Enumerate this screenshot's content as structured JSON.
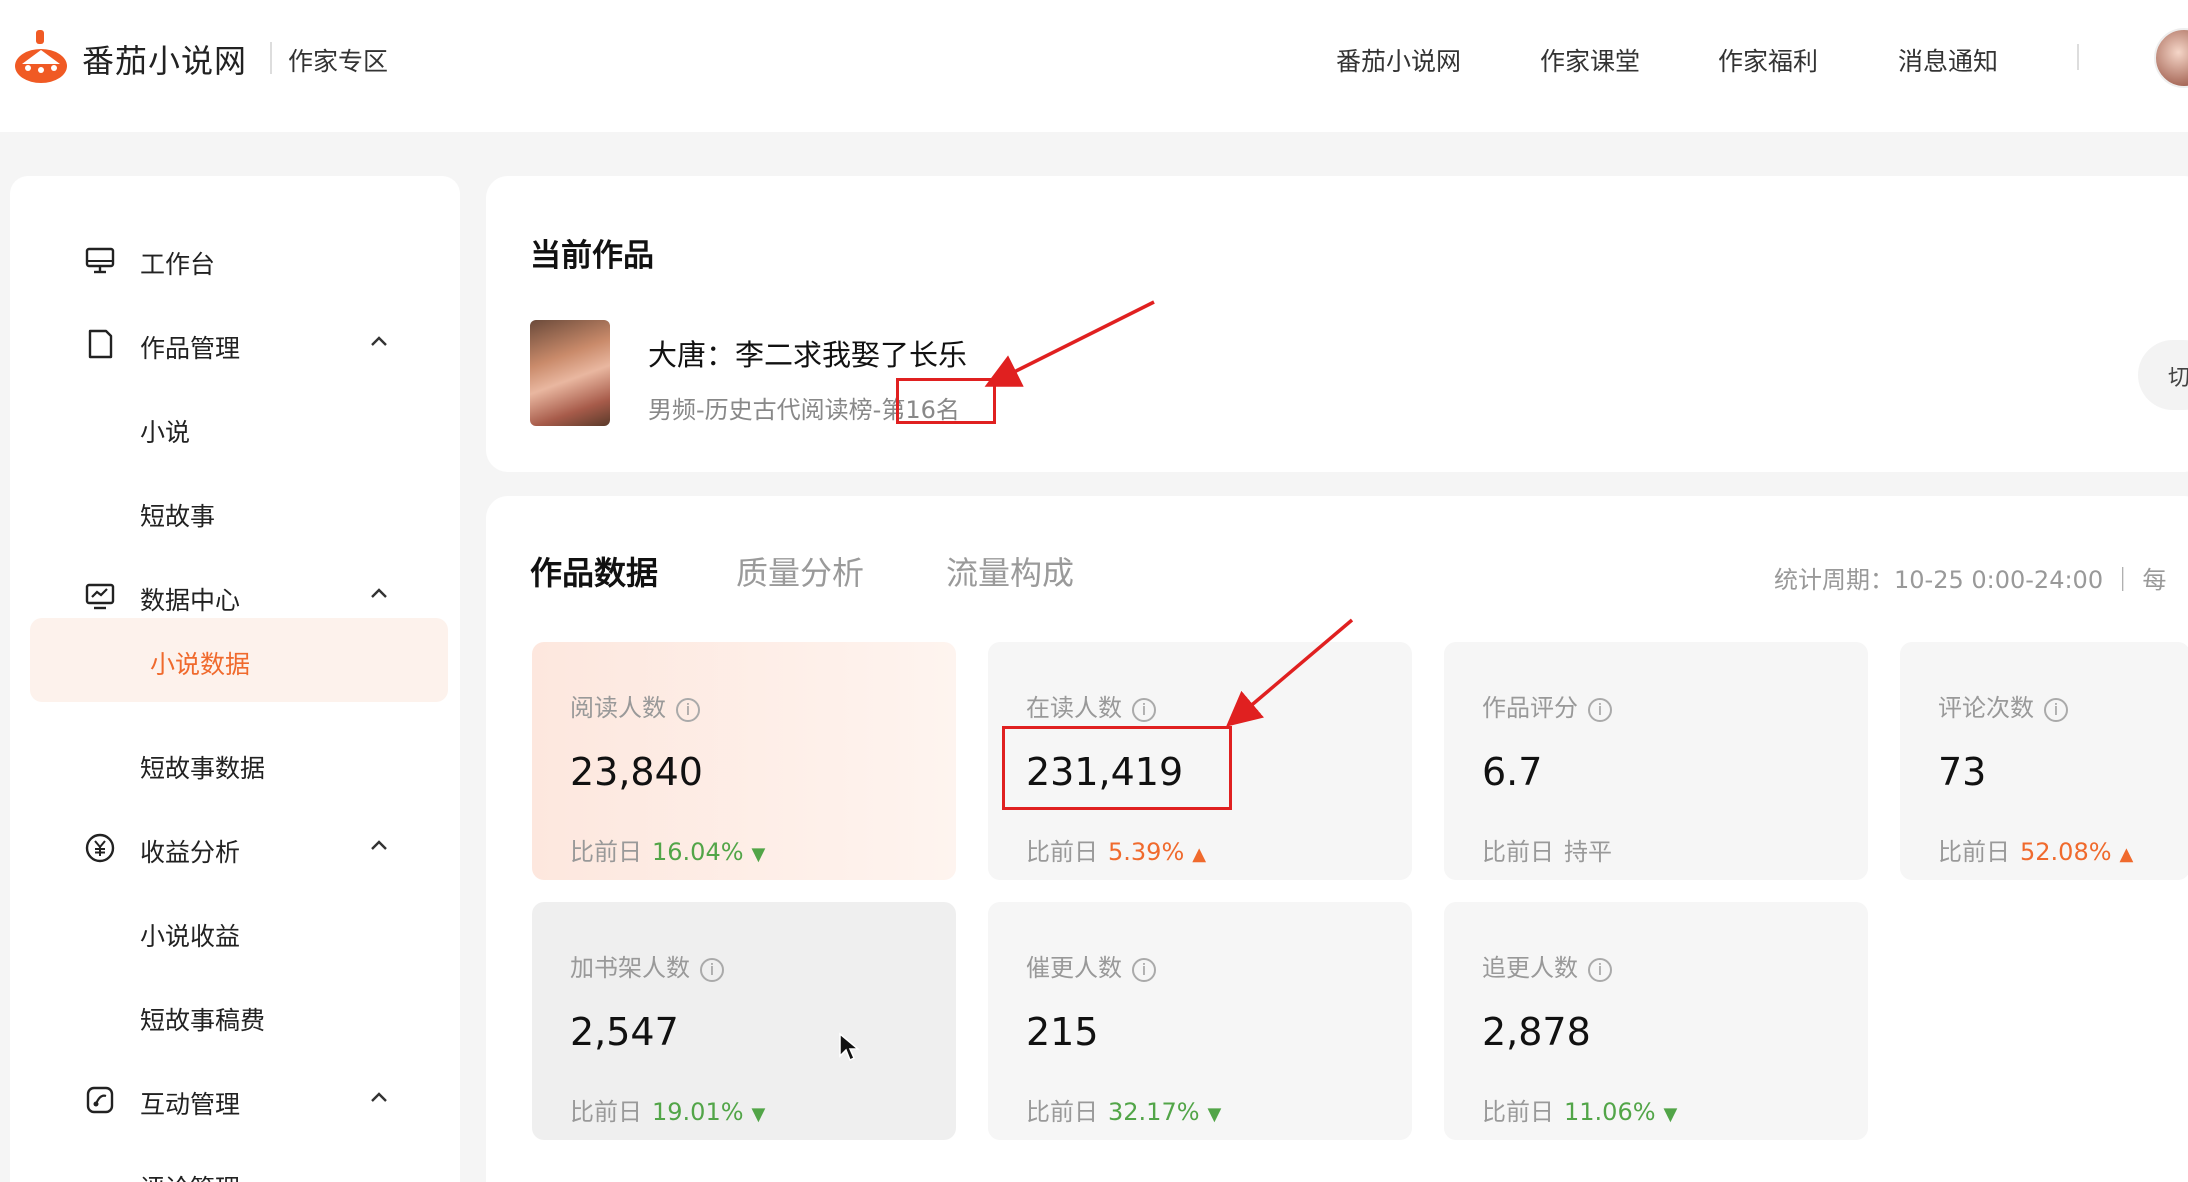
{
  "header": {
    "brand": "番茄小说网",
    "zone": "作家专区",
    "nav": [
      "番茄小说网",
      "作家课堂",
      "作家福利",
      "消息通知"
    ]
  },
  "sidebar": {
    "items": [
      {
        "label": "工作台"
      },
      {
        "label": "作品管理"
      },
      {
        "label": "小说"
      },
      {
        "label": "短故事"
      },
      {
        "label": "数据中心"
      },
      {
        "label": "小说数据"
      },
      {
        "label": "短故事数据"
      },
      {
        "label": "收益分析"
      },
      {
        "label": "小说收益"
      },
      {
        "label": "短故事稿费"
      },
      {
        "label": "互动管理"
      },
      {
        "label": "评论管理"
      }
    ]
  },
  "current_work": {
    "title": "当前作品",
    "book_title": "大唐：李二求我娶了长乐",
    "rank_prefix": "男频-历史古代阅读榜-",
    "rank": "第16名",
    "switch_label": "切"
  },
  "tabs": [
    "作品数据",
    "质量分析",
    "流量构成"
  ],
  "stat_period": "统计周期：10-25 0:00-24:00 ｜ 每",
  "compare_label": "比前日",
  "cards": [
    {
      "label": "阅读人数",
      "value": "23,840",
      "pct": "16.04%",
      "dir": "down"
    },
    {
      "label": "在读人数",
      "value": "231,419",
      "pct": "5.39%",
      "dir": "up"
    },
    {
      "label": "作品评分",
      "value": "6.7",
      "pct": "持平",
      "dir": "flat"
    },
    {
      "label": "评论次数",
      "value": "73",
      "pct": "52.08%",
      "dir": "up"
    },
    {
      "label": "加书架人数",
      "value": "2,547",
      "pct": "19.01%",
      "dir": "down"
    },
    {
      "label": "催更人数",
      "value": "215",
      "pct": "32.17%",
      "dir": "down"
    },
    {
      "label": "追更人数",
      "value": "2,878",
      "pct": "11.06%",
      "dir": "down"
    }
  ],
  "colors": {
    "accent": "#f06a2d",
    "up": "#f06a2d",
    "down": "#52a548",
    "annotation": "#e02020"
  }
}
